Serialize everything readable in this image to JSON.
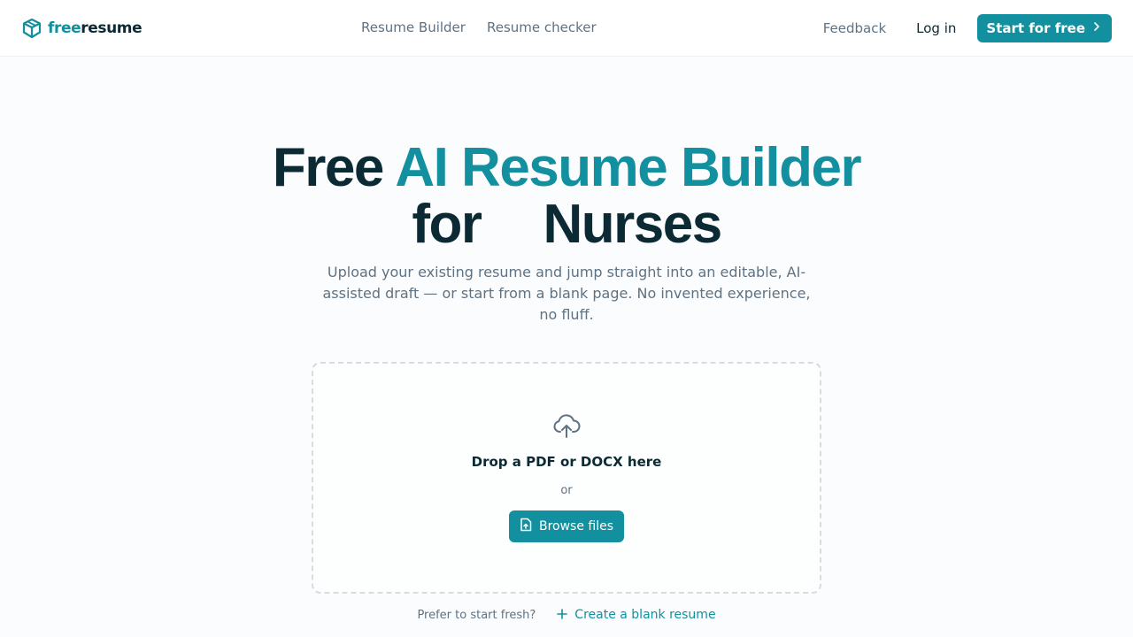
{
  "nav": {
    "logo": {
      "part1": "free",
      "part2": "resume",
      "icon": "box-logo-icon"
    },
    "links": [
      {
        "label": "Resume Builder"
      },
      {
        "label": "Resume checker"
      }
    ],
    "feedback": "Feedback",
    "login": "Log in",
    "cta": {
      "label": "Start for free",
      "icon": "chevron-right-icon"
    }
  },
  "hero": {
    "title_part1": "Free",
    "title_part2": "AI Resume Builder",
    "title_part3": "for",
    "title_part4": "Nurses",
    "subtitle": "Upload your existing resume and jump straight into an editable, AI-assisted draft — or start from a blank page. No invented experience, no fluff."
  },
  "upload": {
    "icon": "cloud-upload-icon",
    "drop_text": "Drop a PDF or DOCX here",
    "or_text": "or",
    "browse_label": "Browse files",
    "browse_icon": "file-upload-icon"
  },
  "footer_row": {
    "prompt": "Prefer to start fresh?",
    "blank_label": "Create a blank resume",
    "blank_icon": "plus-icon"
  },
  "colors": {
    "accent": "#12909f",
    "text_dark": "#0c2a33",
    "text_muted": "#5f7282",
    "border": "#d6dde2"
  }
}
